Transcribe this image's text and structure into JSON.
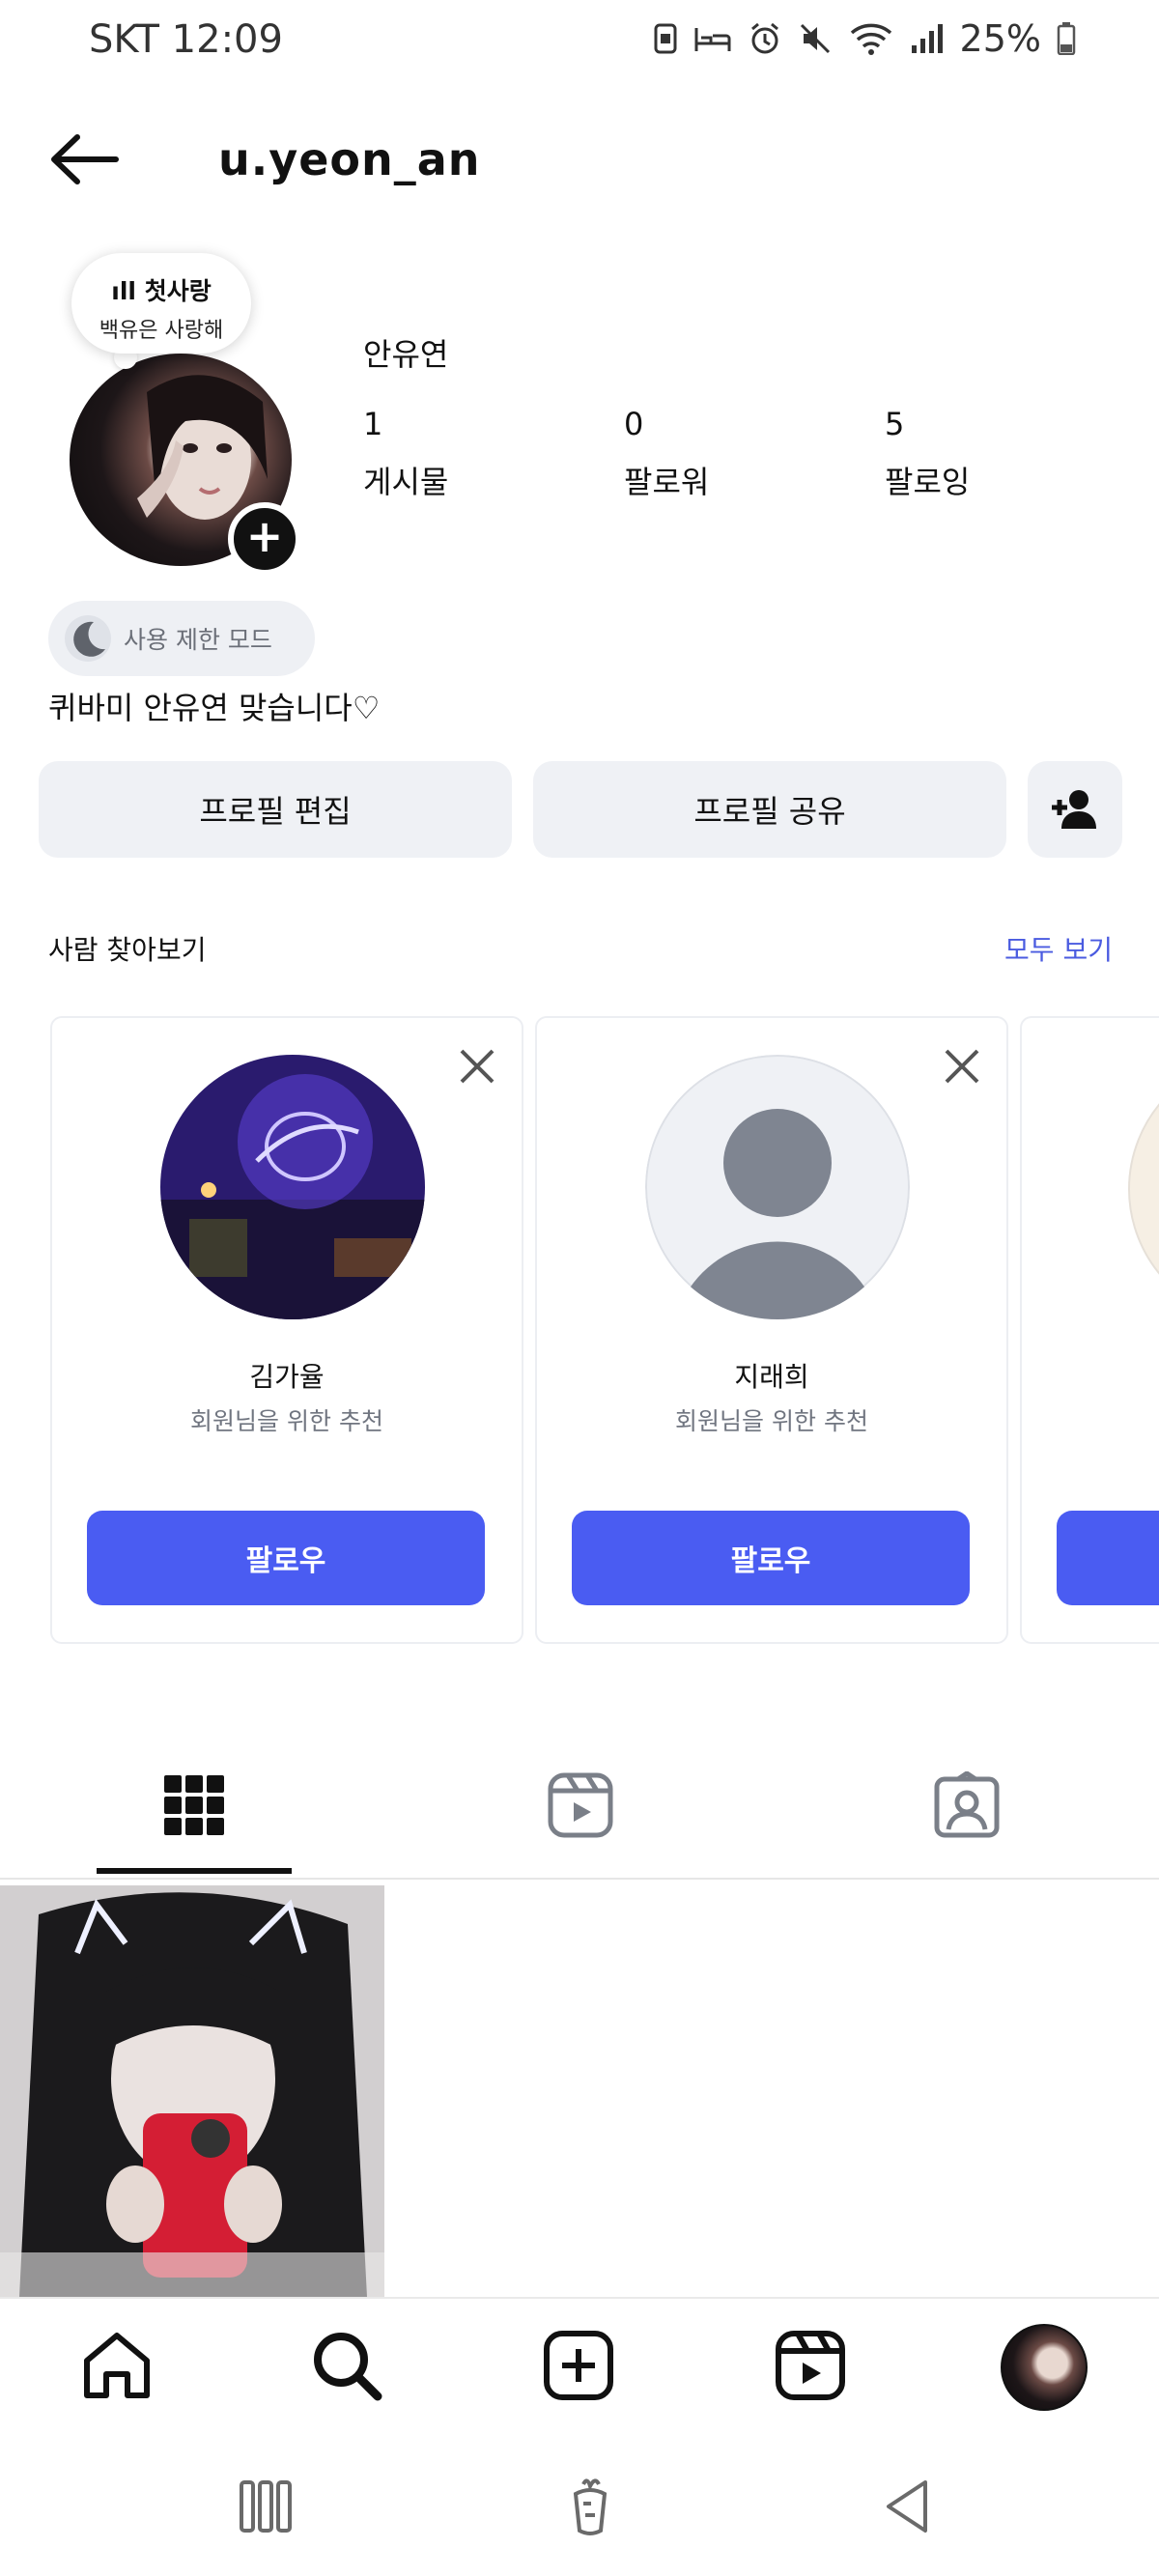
{
  "status_bar": {
    "carrier_time": "SKT 12:09",
    "battery": "25%"
  },
  "header": {
    "username": "u.yeon_an"
  },
  "profile": {
    "note_line1": "ıll 첫사랑",
    "note_line2": "백유은 사랑해",
    "display_name": "안유연",
    "stats": [
      {
        "value": "1",
        "label": "게시물"
      },
      {
        "value": "0",
        "label": "팔로워"
      },
      {
        "value": "5",
        "label": "팔로잉"
      }
    ],
    "restricted_mode": "사용 제한 모드",
    "bio": "퀴바미 안유연 맞습니다♡"
  },
  "actions": {
    "edit_profile": "프로필 편집",
    "share_profile": "프로필 공유"
  },
  "discover": {
    "title": "사람 찾아보기",
    "see_all": "모두 보기",
    "cards": [
      {
        "name": "김가율",
        "subtitle": "회원님을 위한 추천",
        "follow": "팔로우"
      },
      {
        "name": "지래희",
        "subtitle": "회원님을 위한 추천",
        "follow": "팔로우"
      }
    ]
  },
  "icons": {
    "tabs": [
      "grid-icon",
      "reels-icon",
      "tagged-icon"
    ],
    "bottom_nav": [
      "home-icon",
      "search-icon",
      "create-icon",
      "reels-icon",
      "profile-avatar"
    ],
    "system_nav": [
      "recents-icon",
      "home-carrot-icon",
      "back-icon"
    ]
  },
  "colors": {
    "accent": "#4a5cf2",
    "link": "#4a5be0",
    "button_bg": "#eff1f5"
  }
}
